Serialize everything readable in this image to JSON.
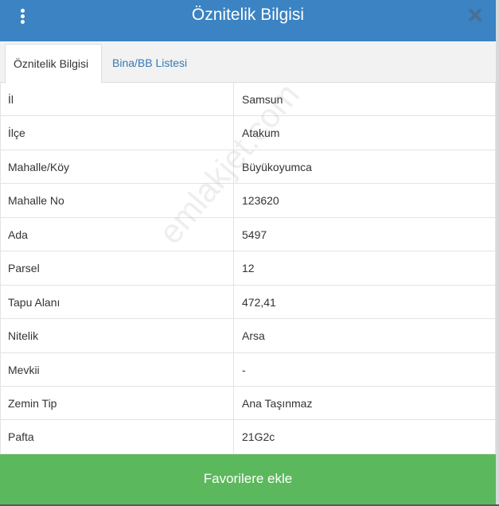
{
  "header": {
    "title": "Öznitelik Bilgisi",
    "menu_icon": "vertical-ellipsis",
    "close_icon": "close-x",
    "color": "#3b83c2"
  },
  "tabs": [
    {
      "label": "Öznitelik Bilgisi",
      "active": true
    },
    {
      "label": "Bina/BB Listesi",
      "active": false
    }
  ],
  "rows": [
    {
      "key": "İl",
      "value": "Samsun"
    },
    {
      "key": "İlçe",
      "value": "Atakum"
    },
    {
      "key": "Mahalle/Köy",
      "value": "Büyükoyumca"
    },
    {
      "key": "Mahalle No",
      "value": "123620"
    },
    {
      "key": "Ada",
      "value": "5497"
    },
    {
      "key": "Parsel",
      "value": "12"
    },
    {
      "key": "Tapu Alanı",
      "value": "472,41"
    },
    {
      "key": "Nitelik",
      "value": "Arsa"
    },
    {
      "key": "Mevkii",
      "value": "-"
    },
    {
      "key": "Zemin Tip",
      "value": "Ana Taşınmaz"
    },
    {
      "key": "Pafta",
      "value": "21G2c"
    }
  ],
  "watermark": "emlakjet.com",
  "footer": {
    "button_label": "Favorilere ekle",
    "color": "#5cb85c"
  }
}
